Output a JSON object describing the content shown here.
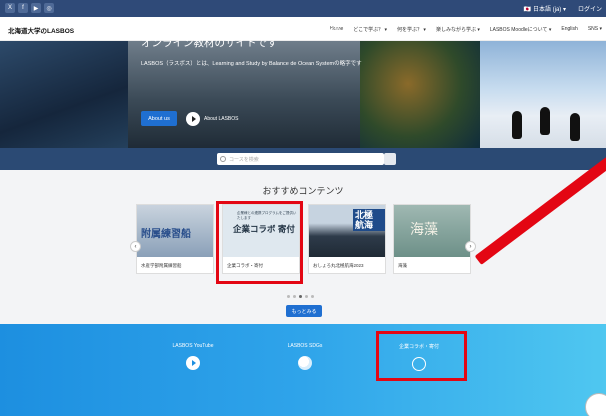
{
  "topbar": {
    "social": [
      "X",
      "f",
      "▶",
      "◎"
    ],
    "language": "🇯🇵 日本語 (ja) ▾",
    "login": "ログイン"
  },
  "header": {
    "logo": "北海道大学のLASBOS",
    "nav": [
      "Home",
      "どこで学ぶ？ ▾",
      "何を学ぶ？ ▾",
      "楽しみながら学ぶ ▾",
      "LASBOS Moodleについて ▾",
      "English",
      "SNS ▾"
    ]
  },
  "hero": {
    "line1": "北海道大学のLASBOSは海と生き物を学ぶ",
    "line2": "オンライン教材のサイトです",
    "desc": "LASBOS（ラスボス）とは、Learning and Study by Balance de Ocean Systemの略字です",
    "about_btn": "About us",
    "about_lasbos": "About LASBOS"
  },
  "search": {
    "placeholder": "コースを検索"
  },
  "recommend": {
    "title": "おすすめコンテンツ",
    "cards": [
      {
        "image_text": "附属練習船",
        "caption": "水産学部附属練習船"
      },
      {
        "image_sub": "企業様との連携プログラムをご提供いたします",
        "image_text": "企業コラボ 寄付",
        "caption": "企業コラボ・寄付"
      },
      {
        "image_text": "北極 航海",
        "caption": "おしょろ丸北極航海2023"
      },
      {
        "image_text": "海藻",
        "caption": "海藻"
      }
    ],
    "prev": "‹",
    "next": "›",
    "more_btn": "もっとみる"
  },
  "band": {
    "items": [
      {
        "label": "LASBOS YouTube",
        "icon": "play-circle-icon"
      },
      {
        "label": "LASBOS SDGs",
        "icon": "globe-icon"
      },
      {
        "label": "企業コラボ・寄付",
        "icon": "handshake-icon"
      }
    ]
  },
  "colors": {
    "accent": "#1f6fd1",
    "navy": "#2b4a74",
    "highlight": "#e30613"
  }
}
